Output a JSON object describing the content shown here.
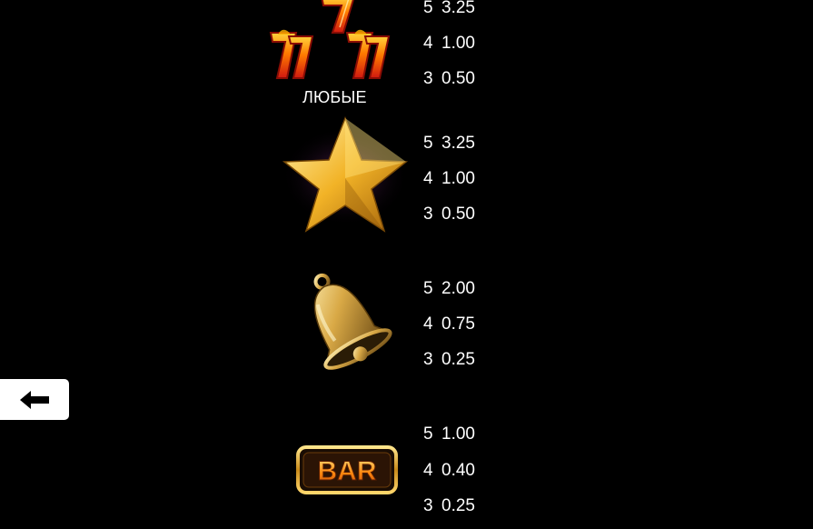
{
  "symbols": [
    {
      "icon": "triple-seven-icon",
      "caption": "ЛЮБЫЕ",
      "payouts": [
        {
          "count": "5",
          "value": "3.25"
        },
        {
          "count": "4",
          "value": "1.00"
        },
        {
          "count": "3",
          "value": "0.50"
        }
      ]
    },
    {
      "icon": "gold-star-icon",
      "payouts": [
        {
          "count": "5",
          "value": "3.25"
        },
        {
          "count": "4",
          "value": "1.00"
        },
        {
          "count": "3",
          "value": "0.50"
        }
      ]
    },
    {
      "icon": "gold-bell-icon",
      "payouts": [
        {
          "count": "5",
          "value": "2.00"
        },
        {
          "count": "4",
          "value": "0.75"
        },
        {
          "count": "3",
          "value": "0.25"
        }
      ]
    },
    {
      "icon": "bar-icon",
      "label": "BAR",
      "payouts": [
        {
          "count": "5",
          "value": "1.00"
        },
        {
          "count": "4",
          "value": "0.40"
        },
        {
          "count": "3",
          "value": "0.25"
        }
      ]
    }
  ],
  "navigation": {
    "back_icon": "arrow-left-icon"
  },
  "colors": {
    "background": "#000000",
    "text": "#ffffff",
    "gold": "#f2c14e",
    "fire_red": "#e0281c",
    "fire_orange": "#ff8a00"
  }
}
